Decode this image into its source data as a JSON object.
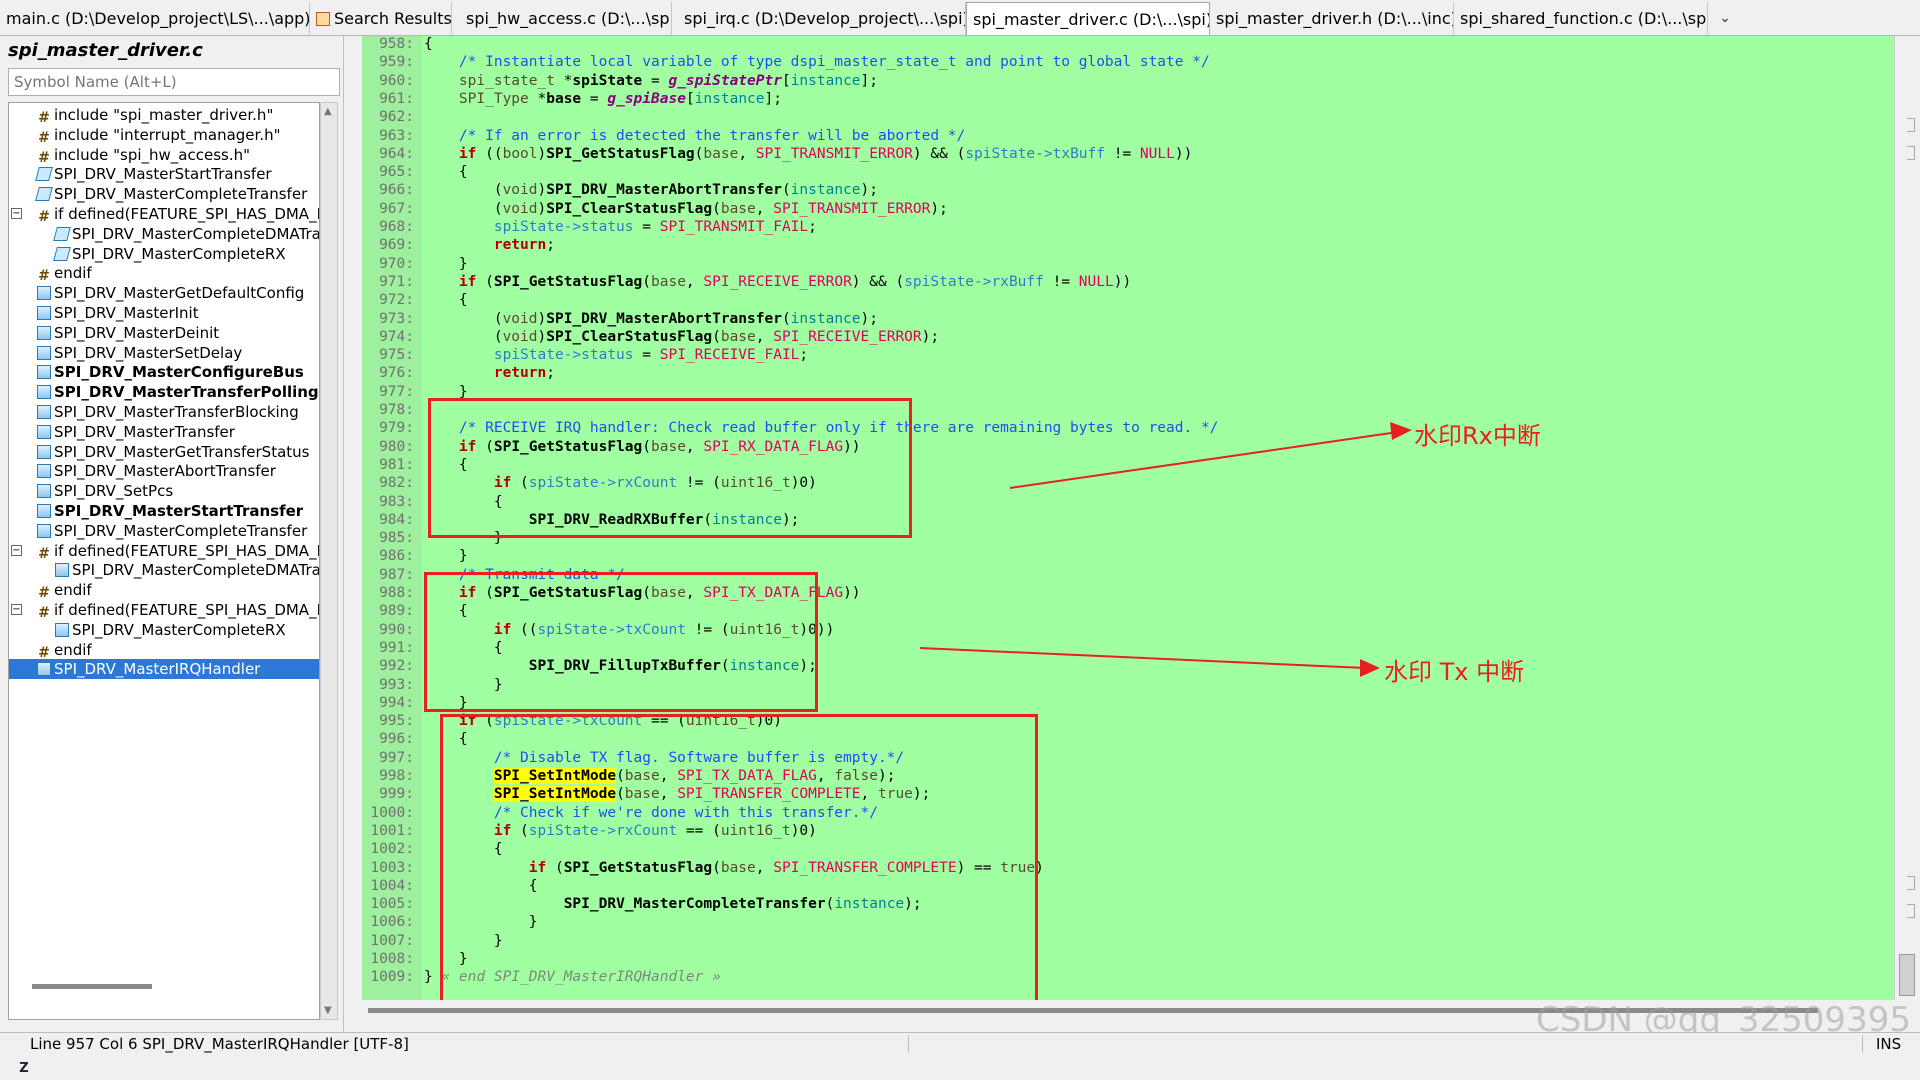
{
  "tabs": [
    {
      "label": "main.c (D:\\Develop_project\\LS\\...\\app)",
      "active": false
    },
    {
      "label": "Search Results",
      "active": false,
      "icon": "search-results-icon"
    },
    {
      "label": "spi_hw_access.c (D:\\...\\spi)",
      "active": false
    },
    {
      "label": "spi_irq.c (D:\\Develop_project\\...\\spi)",
      "active": false
    },
    {
      "label": "spi_master_driver.c (D:\\...\\spi)",
      "active": true
    },
    {
      "label": "spi_master_driver.h (D:\\...\\inc)",
      "active": false
    },
    {
      "label": "spi_shared_function.c (D:\\...\\spi)",
      "active": false
    }
  ],
  "tab_close": "✖",
  "tab_menu": "⌄",
  "sidebar": {
    "file_title": "spi_master_driver.c",
    "search_placeholder": "Symbol Name (Alt+L)",
    "items": [
      {
        "label": "include \"spi_master_driver.h\"",
        "icon": "hash-icon",
        "indent": 0
      },
      {
        "label": "include \"interrupt_manager.h\"",
        "icon": "hash-icon",
        "indent": 0
      },
      {
        "label": "include \"spi_hw_access.h\"",
        "icon": "hash-icon",
        "indent": 0
      },
      {
        "label": "SPI_DRV_MasterStartTransfer",
        "icon": "prototype-icon",
        "indent": 0
      },
      {
        "label": "SPI_DRV_MasterCompleteTransfer",
        "icon": "prototype-icon",
        "indent": 0
      },
      {
        "label": "if defined(FEATURE_SPI_HAS_DMA_EN",
        "icon": "hash-icon",
        "indent": 0,
        "expander": "−"
      },
      {
        "label": "SPI_DRV_MasterCompleteDMATra",
        "icon": "prototype-icon",
        "indent": 1
      },
      {
        "label": "SPI_DRV_MasterCompleteRX",
        "icon": "prototype-icon",
        "indent": 1
      },
      {
        "label": "endif",
        "icon": "hash-icon",
        "indent": 0
      },
      {
        "label": "SPI_DRV_MasterGetDefaultConfig",
        "icon": "function-icon",
        "indent": 0
      },
      {
        "label": "SPI_DRV_MasterInit",
        "icon": "function-icon",
        "indent": 0
      },
      {
        "label": "SPI_DRV_MasterDeinit",
        "icon": "function-icon",
        "indent": 0
      },
      {
        "label": "SPI_DRV_MasterSetDelay",
        "icon": "function-icon",
        "indent": 0
      },
      {
        "label": "SPI_DRV_MasterConfigureBus",
        "icon": "function-icon",
        "indent": 0,
        "bold": true
      },
      {
        "label": "SPI_DRV_MasterTransferPolling",
        "icon": "function-icon",
        "indent": 0,
        "bold": true
      },
      {
        "label": "SPI_DRV_MasterTransferBlocking",
        "icon": "function-icon",
        "indent": 0
      },
      {
        "label": "SPI_DRV_MasterTransfer",
        "icon": "function-icon",
        "indent": 0
      },
      {
        "label": "SPI_DRV_MasterGetTransferStatus",
        "icon": "function-icon",
        "indent": 0
      },
      {
        "label": "SPI_DRV_MasterAbortTransfer",
        "icon": "function-icon",
        "indent": 0
      },
      {
        "label": "SPI_DRV_SetPcs",
        "icon": "function-icon",
        "indent": 0
      },
      {
        "label": "SPI_DRV_MasterStartTransfer",
        "icon": "function-icon",
        "indent": 0,
        "bold": true
      },
      {
        "label": "SPI_DRV_MasterCompleteTransfer",
        "icon": "function-icon",
        "indent": 0
      },
      {
        "label": "if defined(FEATURE_SPI_HAS_DMA_EN",
        "icon": "hash-icon",
        "indent": 0,
        "expander": "−"
      },
      {
        "label": "SPI_DRV_MasterCompleteDMATra",
        "icon": "function-icon",
        "indent": 1
      },
      {
        "label": "endif",
        "icon": "hash-icon",
        "indent": 0
      },
      {
        "label": "if defined(FEATURE_SPI_HAS_DMA_EN",
        "icon": "hash-icon",
        "indent": 0,
        "expander": "−"
      },
      {
        "label": "SPI_DRV_MasterCompleteRX",
        "icon": "function-icon",
        "indent": 1
      },
      {
        "label": "endif",
        "icon": "hash-icon",
        "indent": 0
      },
      {
        "label": "SPI_DRV_MasterIRQHandler",
        "icon": "function-icon",
        "indent": 0,
        "selected": true
      }
    ],
    "bottom_icons": [
      "az-sort-icon",
      "list-icon",
      "symbol-type-icon",
      "book-icon",
      "gear-icon"
    ],
    "az_label": "A-Z"
  },
  "code": {
    "lines": [
      {
        "n": "958:",
        "html": "{"
      },
      {
        "n": "959:",
        "html": "    <span class=\"cm\">/* Instantiate local variable of type dspi_master_state_t and point to global state */</span>"
      },
      {
        "n": "960:",
        "html": "    <span class=\"ty\">spi_state_t</span> *<span class=\"fn\">spiState</span> = <span class=\"gv\">g_spiStatePtr</span>[<span class=\"pr\">instance</span>];"
      },
      {
        "n": "961:",
        "html": "    <span class=\"ty\">SPI_Type</span> *<span class=\"fn\">base</span> = <span class=\"gv\">g_spiBase</span>[<span class=\"pr\">instance</span>];"
      },
      {
        "n": "962:",
        "html": ""
      },
      {
        "n": "963:",
        "html": "    <span class=\"cm\">/* If an error is detected the transfer will be aborted */</span>"
      },
      {
        "n": "964:",
        "html": "    <span class=\"kw\">if</span> ((<span class=\"ty\">bool</span>)<span class=\"fn\">SPI_GetStatusFlag</span>(<span class=\"ty\">base</span>, <span class=\"ma\">SPI_TRANSMIT_ERROR</span>) &amp;&amp; (<span class=\"va\">spiState-&gt;txBuff</span> != <span class=\"ma\">NULL</span>))"
      },
      {
        "n": "965:",
        "html": "    {"
      },
      {
        "n": "966:",
        "html": "        (<span class=\"ty\">void</span>)<span class=\"fn\">SPI_DRV_MasterAbortTransfer</span>(<span class=\"pr\">instance</span>);"
      },
      {
        "n": "967:",
        "html": "        (<span class=\"ty\">void</span>)<span class=\"fn\">SPI_ClearStatusFlag</span>(<span class=\"ty\">base</span>, <span class=\"ma\">SPI_TRANSMIT_ERROR</span>);"
      },
      {
        "n": "968:",
        "html": "        <span class=\"va\">spiState-&gt;status</span> = <span class=\"ma\">SPI_TRANSMIT_FAIL</span>;"
      },
      {
        "n": "969:",
        "html": "        <span class=\"kw\">return</span>;"
      },
      {
        "n": "970:",
        "html": "    }"
      },
      {
        "n": "971:",
        "html": "    <span class=\"kw\">if</span> (<span class=\"fn\">SPI_GetStatusFlag</span>(<span class=\"ty\">base</span>, <span class=\"ma\">SPI_RECEIVE_ERROR</span>) &amp;&amp; (<span class=\"va\">spiState-&gt;rxBuff</span> != <span class=\"ma\">NULL</span>))"
      },
      {
        "n": "972:",
        "html": "    {"
      },
      {
        "n": "973:",
        "html": "        (<span class=\"ty\">void</span>)<span class=\"fn\">SPI_DRV_MasterAbortTransfer</span>(<span class=\"pr\">instance</span>);"
      },
      {
        "n": "974:",
        "html": "        (<span class=\"ty\">void</span>)<span class=\"fn\">SPI_ClearStatusFlag</span>(<span class=\"ty\">base</span>, <span class=\"ma\">SPI_RECEIVE_ERROR</span>);"
      },
      {
        "n": "975:",
        "html": "        <span class=\"va\">spiState-&gt;status</span> = <span class=\"ma\">SPI_RECEIVE_FAIL</span>;"
      },
      {
        "n": "976:",
        "html": "        <span class=\"kw\">return</span>;"
      },
      {
        "n": "977:",
        "html": "    }"
      },
      {
        "n": "978:",
        "html": ""
      },
      {
        "n": "979:",
        "html": "    <span class=\"cm\">/* RECEIVE IRQ handler: Check read buffer only if there are remaining bytes to read. */</span>"
      },
      {
        "n": "980:",
        "html": "    <span class=\"kw\">if</span> (<span class=\"fn\">SPI_GetStatusFlag</span>(<span class=\"ty\">base</span>, <span class=\"ma\">SPI_RX_DATA_FLAG</span>))"
      },
      {
        "n": "981:",
        "html": "    {"
      },
      {
        "n": "982:",
        "html": "        <span class=\"kw\">if</span> (<span class=\"va\">spiState-&gt;rxCount</span> != (<span class=\"ty\">uint16_t</span>)0)"
      },
      {
        "n": "983:",
        "html": "        {"
      },
      {
        "n": "984:",
        "html": "            <span class=\"fn\">SPI_DRV_ReadRXBuffer</span>(<span class=\"pr\">instance</span>);"
      },
      {
        "n": "985:",
        "html": "        }"
      },
      {
        "n": "986:",
        "html": "    }"
      },
      {
        "n": "987:",
        "html": "    <span class=\"cm\">/* Transmit data */</span>"
      },
      {
        "n": "988:",
        "html": "    <span class=\"kw\">if</span> (<span class=\"fn\">SPI_GetStatusFlag</span>(<span class=\"ty\">base</span>, <span class=\"ma\">SPI_TX_DATA_FLAG</span>))"
      },
      {
        "n": "989:",
        "html": "    {"
      },
      {
        "n": "990:",
        "html": "        <span class=\"kw\">if</span> ((<span class=\"va\">spiState-&gt;txCount</span> != (<span class=\"ty\">uint16_t</span>)0))"
      },
      {
        "n": "991:",
        "html": "        {"
      },
      {
        "n": "992:",
        "html": "            <span class=\"fn\">SPI_DRV_FillupTxBuffer</span>(<span class=\"pr\">instance</span>);"
      },
      {
        "n": "993:",
        "html": "        }"
      },
      {
        "n": "994:",
        "html": "    }"
      },
      {
        "n": "995:",
        "html": "    <span class=\"kw\">if</span> (<span class=\"va\">spiState-&gt;txCount</span> == (<span class=\"ty\">uint16_t</span>)0)"
      },
      {
        "n": "996:",
        "html": "    {"
      },
      {
        "n": "997:",
        "html": "        <span class=\"cm\">/* Disable TX flag. Software buffer is empty.*/</span>"
      },
      {
        "n": "998:",
        "html": "        <span class=\"hl\">SPI_SetIntMode</span>(<span class=\"ty\">base</span>, <span class=\"ma\">SPI_TX_DATA_FLAG</span>, <span class=\"ty\">false</span>);"
      },
      {
        "n": "999:",
        "html": "        <span class=\"hl\">SPI_SetIntMode</span>(<span class=\"ty\">base</span>, <span class=\"ma\">SPI_TRANSFER_COMPLETE</span>, <span class=\"ty\">true</span>);"
      },
      {
        "n": "1000:",
        "html": "        <span class=\"cm\">/* Check if we're done with this transfer.*/</span>"
      },
      {
        "n": "1001:",
        "html": "        <span class=\"kw\">if</span> (<span class=\"va\">spiState-&gt;rxCount</span> == (<span class=\"ty\">uint16_t</span>)0)"
      },
      {
        "n": "1002:",
        "html": "        {"
      },
      {
        "n": "1003:",
        "html": "            <span class=\"kw\">if</span> (<span class=\"fn\">SPI_GetStatusFlag</span>(<span class=\"ty\">base</span>, <span class=\"ma\">SPI_TRANSFER_COMPLETE</span>) == <span class=\"ty\">true</span>)"
      },
      {
        "n": "1004:",
        "html": "            {"
      },
      {
        "n": "1005:",
        "html": "                <span class=\"fn\">SPI_DRV_MasterCompleteTransfer</span>(<span class=\"pr\">instance</span>);"
      },
      {
        "n": "1006:",
        "html": "            }"
      },
      {
        "n": "1007:",
        "html": "        }"
      },
      {
        "n": "1008:",
        "html": "    }"
      },
      {
        "n": "1009:",
        "html": "} <span class=\"dim\">« end SPI_DRV_MasterIRQHandler »</span>"
      }
    ]
  },
  "annotations": {
    "rx_label": "水印Rx中断",
    "tx_label": "水印 Tx 中断",
    "color": "#e82020"
  },
  "status": {
    "position": "Line 957  Col 6   SPI_DRV_MasterIRQHandler [UTF-8]",
    "mode": "INS"
  },
  "watermark": "CSDN @qq_32509395",
  "colors": {
    "editor_bg": "#a0ffa0",
    "selection": "#2b78d6",
    "highlight": "#ffff00"
  }
}
